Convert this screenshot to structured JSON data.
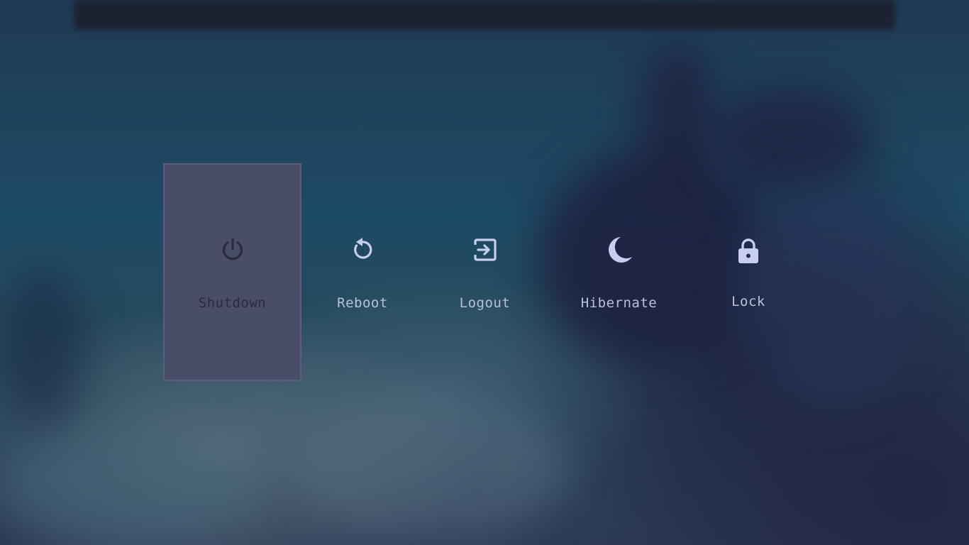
{
  "menu": {
    "options": [
      {
        "label": "Shutdown",
        "icon": "power-icon",
        "selected": true
      },
      {
        "label": "Reboot",
        "icon": "reboot-icon",
        "selected": false
      },
      {
        "label": "Logout",
        "icon": "logout-icon",
        "selected": false
      },
      {
        "label": "Hibernate",
        "icon": "moon-icon",
        "selected": false
      },
      {
        "label": "Lock",
        "icon": "lock-icon",
        "selected": false
      }
    ]
  },
  "colors": {
    "selected_background": "#4a4d68",
    "selected_text": "#2a2b3c",
    "label_text": "#b9c0d8",
    "icon_light": "#c8cdf2",
    "icon_dark": "#2a2b3c"
  }
}
